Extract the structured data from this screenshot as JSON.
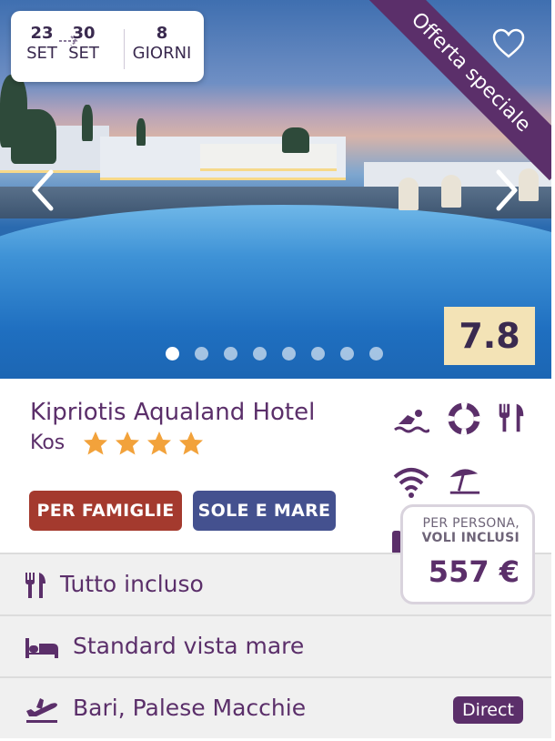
{
  "dates": {
    "start_day": "23",
    "start_month": "SET",
    "end_day": "30",
    "end_month": "SET",
    "duration_num": "8",
    "duration_label": "GIORNI"
  },
  "ribbon": "Offerta speciale",
  "rating": "7.8",
  "carousel": {
    "dots": 8,
    "active_index": 0
  },
  "hotel": {
    "name": "Kipriotis Aqualand Hotel",
    "location": "Kos",
    "stars": 4
  },
  "amenity_icons": [
    "swimming-icon",
    "lifebuoy-icon",
    "restaurant-icon",
    "wifi-icon",
    "beach-umbrella-icon"
  ],
  "tags": [
    {
      "label": "PER FAMIGLIE",
      "color": "#a43a2e"
    },
    {
      "label": "SOLE E MARE",
      "color": "#44518f"
    }
  ],
  "price": {
    "label_line1": "PER PERSONA,",
    "label_line2": "VOLI INCLUSI",
    "amount": "557 €"
  },
  "details": [
    {
      "icon": "fork-knife-icon",
      "text": "Tutto incluso"
    },
    {
      "icon": "bed-icon",
      "text": "Standard vista mare"
    },
    {
      "icon": "plane-departure-icon",
      "text": "Bari, Palese Macchie",
      "badge": "Direct"
    }
  ],
  "colors": {
    "brand": "#5b2f6a",
    "rating_bg": "#f3e3b6",
    "family_tag": "#a43a2e",
    "sea_tag": "#44518f"
  }
}
